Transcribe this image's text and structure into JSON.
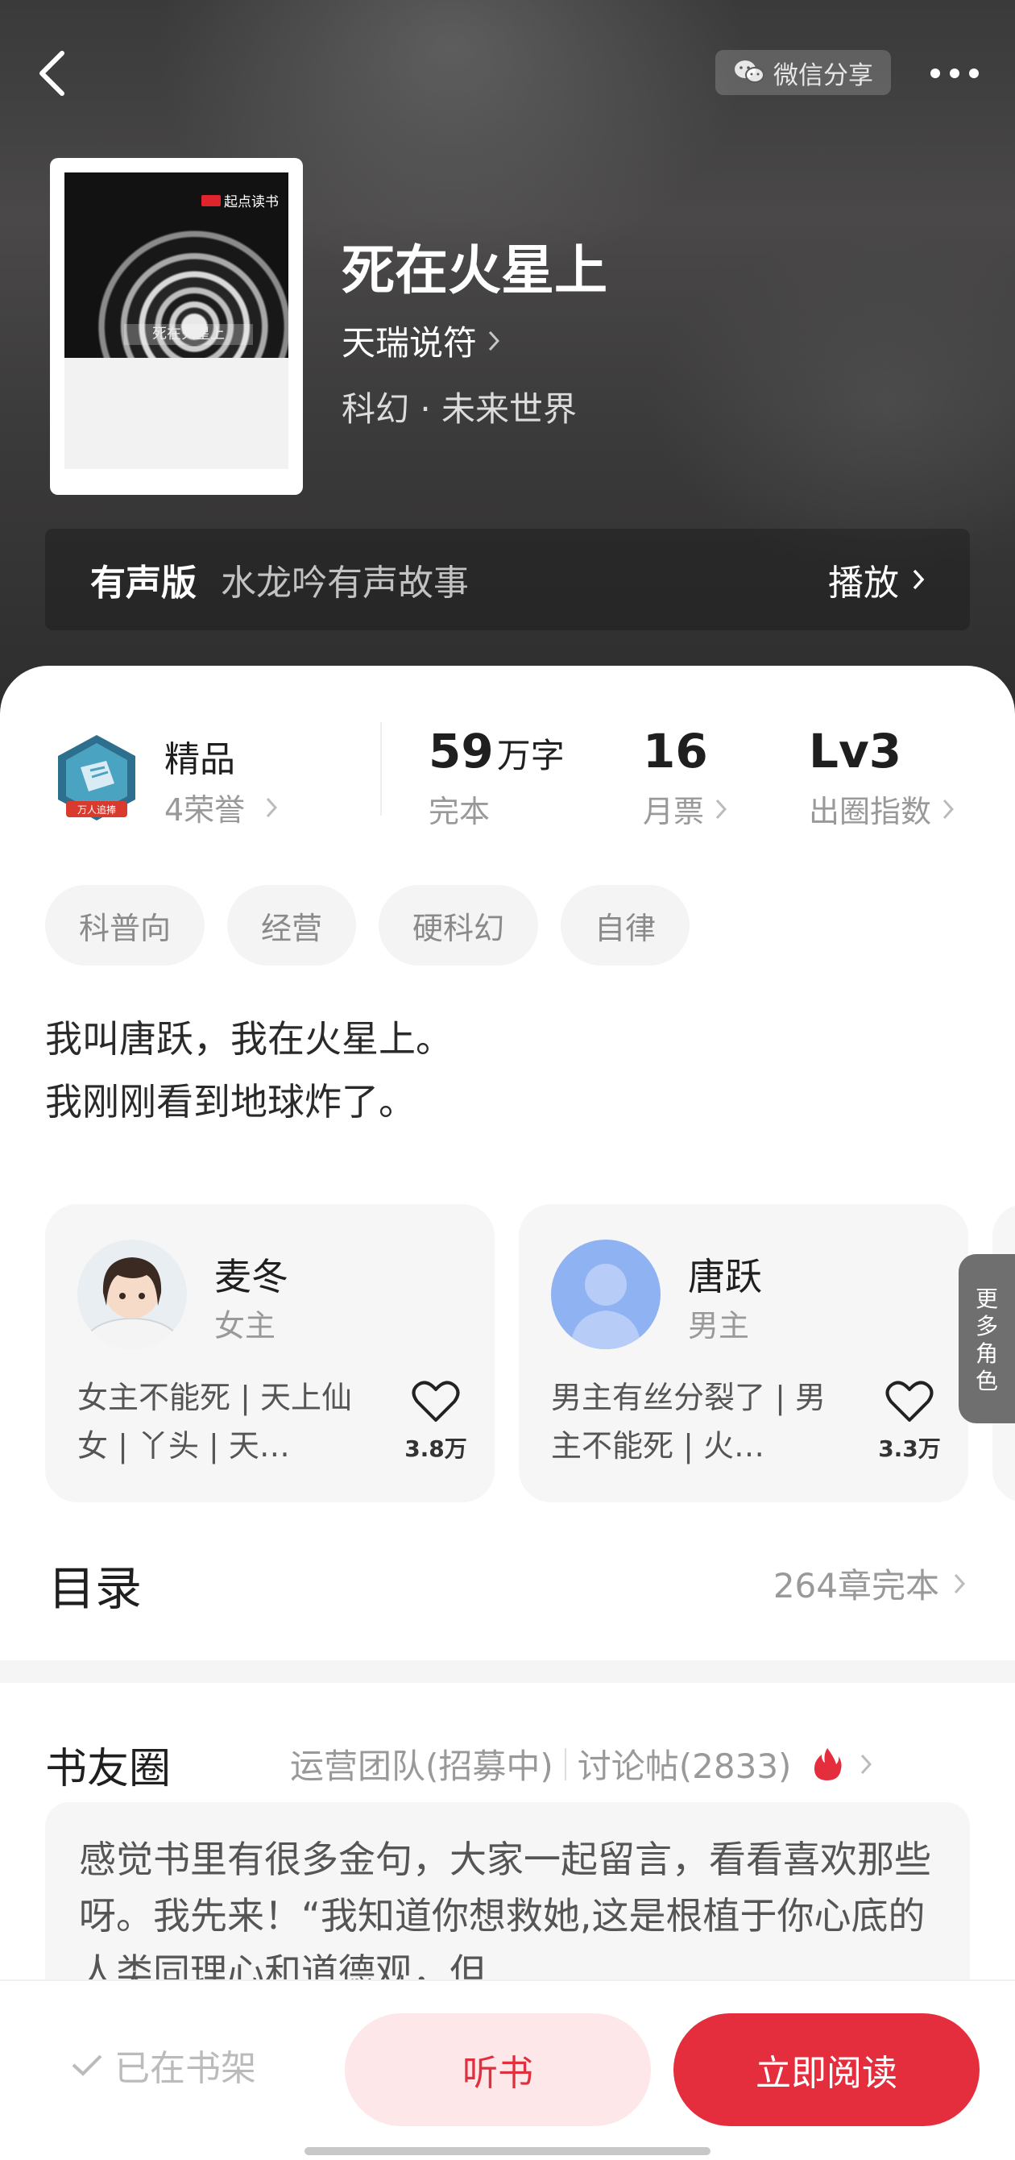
{
  "header": {
    "share_label": "微信分享",
    "icons": {
      "back": "chevron-left-icon",
      "share": "wechat-icon",
      "more": "more-dots-icon"
    }
  },
  "book": {
    "cover": {
      "brand": "起点读书",
      "title": "死在火星上"
    },
    "title": "死在火星上",
    "author": "天瑞说符",
    "genre": "科幻 · 未来世界"
  },
  "audio": {
    "label": "有声版",
    "name": "水龙吟有声故事",
    "play_label": "播放"
  },
  "honor": {
    "badge_text": "万人追捧",
    "name": "精品",
    "sub": "4荣誉"
  },
  "stats": [
    {
      "value": "59",
      "unit": "万字",
      "label": "完本"
    },
    {
      "value": "16",
      "unit": "",
      "label": "月票"
    },
    {
      "value": "Lv3",
      "unit": "",
      "label": "出圈指数"
    }
  ],
  "tags": [
    "科普向",
    "经营",
    "硬科幻",
    "自律"
  ],
  "intro": {
    "line1": "我叫唐跃，我在火星上。",
    "line2": "我刚刚看到地球炸了。"
  },
  "characters": [
    {
      "name": "麦冬",
      "role": "女主",
      "desc": "女主不能死 | 天上仙女 | 丫头 | 天…",
      "likes": "3.8万"
    },
    {
      "name": "唐跃",
      "role": "男主",
      "desc": "男主有丝分裂了 | 男主不能死 | 火…",
      "likes": "3.3万"
    }
  ],
  "more_characters": "更多角色",
  "toc": {
    "title": "目录",
    "meta": "264章完本"
  },
  "circle": {
    "title": "书友圈",
    "team": "运营团队(招募中)",
    "posts": "讨论帖(2833)",
    "post_text": "感觉书里有很多金句，大家一起留言，看看喜欢那些呀。我先来！“我知道你想救她,这是根植于你心底的人类同理心和道德观，但…"
  },
  "bottom": {
    "shelf": "已在书架",
    "listen": "听书",
    "read": "立即阅读"
  },
  "colors": {
    "accent": "#e42e3e",
    "listen_bg": "#fde7e8",
    "hero_bg": "#3a3a3a"
  }
}
